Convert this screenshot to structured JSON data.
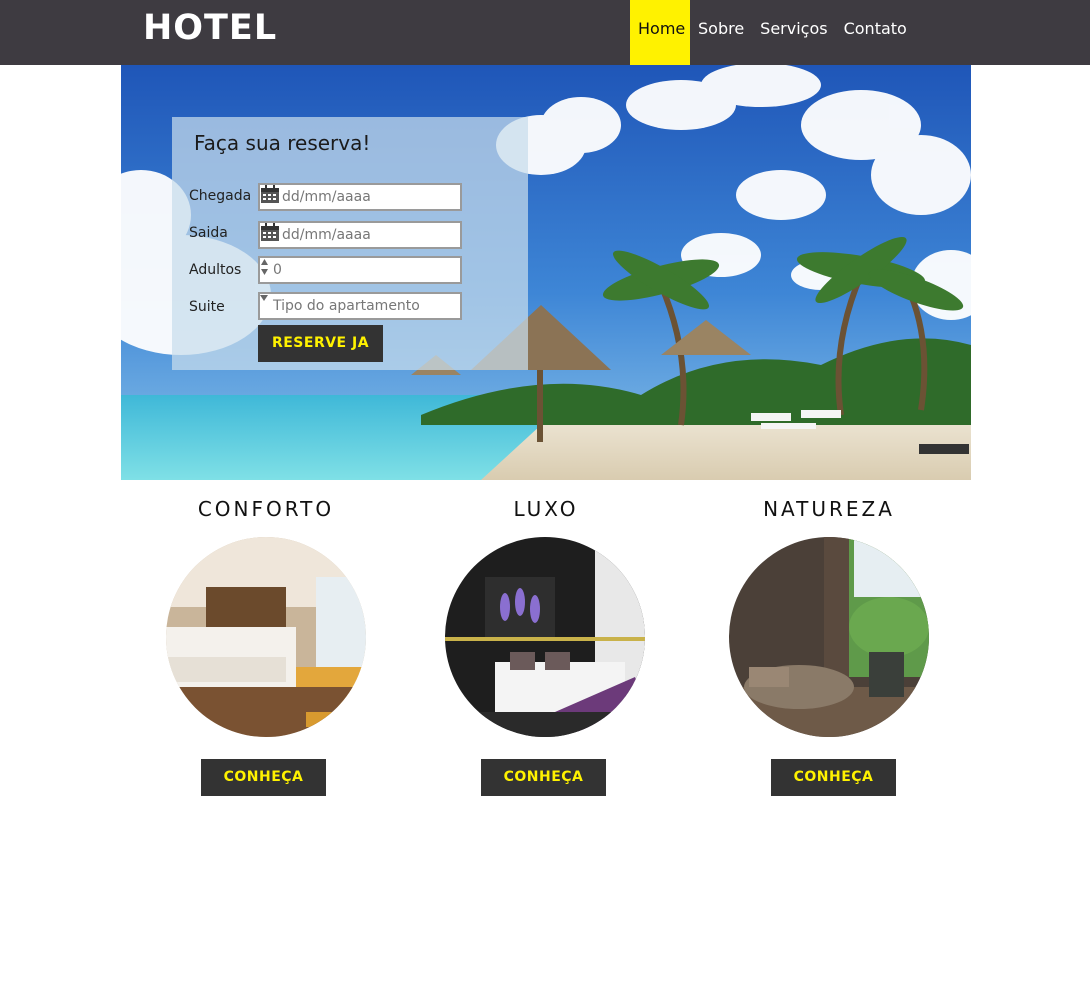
{
  "header": {
    "logo": "HOTEL",
    "nav": [
      "Home",
      "Sobre",
      "Serviços",
      "Contato"
    ],
    "active": "Home"
  },
  "booking": {
    "title": "Faça sua reserva!",
    "arrival_label": "Chegada",
    "arrival_placeholder": "dd/mm/aaaa",
    "departure_label": "Saida",
    "departure_placeholder": "dd/mm/aaaa",
    "adults_label": "Adultos",
    "adults_value": "0",
    "suite_label": "Suite",
    "suite_placeholder": "Tipo do apartamento",
    "submit": "RESERVE JA"
  },
  "features": [
    {
      "title": "CONFORTO",
      "button": "CONHEÇA"
    },
    {
      "title": "LUXO",
      "button": "CONHEÇA"
    },
    {
      "title": "NATUREZA",
      "button": "CONHEÇA"
    }
  ],
  "colors": {
    "header_bg": "#3e3b41",
    "accent": "#fff200",
    "button_bg": "#333333"
  }
}
